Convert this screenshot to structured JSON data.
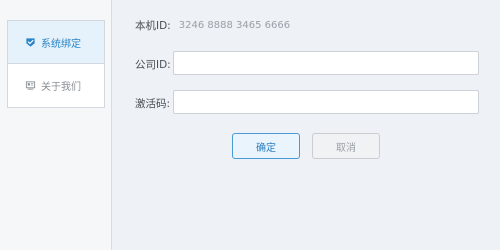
{
  "sidebar": {
    "items": [
      {
        "label": "系统绑定",
        "icon": "shield-check-icon",
        "active": true
      },
      {
        "label": "关于我们",
        "icon": "info-card-icon",
        "active": false
      }
    ]
  },
  "form": {
    "machine_id_label": "本机ID:",
    "machine_id_value": "3246 8888 3465 6666",
    "company_id_label": "公司ID:",
    "company_id_value": "",
    "activation_code_label": "激活码:",
    "activation_code_value": ""
  },
  "buttons": {
    "ok_label": "确定",
    "cancel_label": "取消"
  },
  "colors": {
    "accent": "#2a84c8",
    "active_bg": "#e6f2fb",
    "background": "#eef1f5"
  }
}
